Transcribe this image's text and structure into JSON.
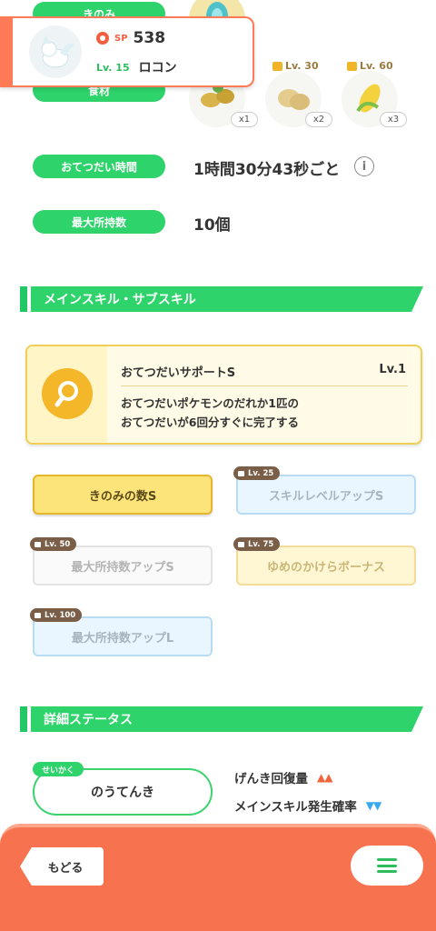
{
  "labels": {
    "berry": "きのみ",
    "ingredient": "食材",
    "help_time": "おてつだい時間",
    "max_carry": "最大所持数"
  },
  "values": {
    "help_time": "1時間30分43秒ごと",
    "max_carry": "10個"
  },
  "pokemon": {
    "sp_label": "SP",
    "sp_value": "538",
    "level": "Lv. 15",
    "name": "ロコン"
  },
  "ingredients": [
    {
      "level": "",
      "count": "x1"
    },
    {
      "level": "Lv. 30",
      "count": "x2"
    },
    {
      "level": "Lv. 60",
      "count": "x3"
    }
  ],
  "sections": {
    "skills": "メインスキル・サブスキル",
    "details": "詳細ステータス"
  },
  "main_skill": {
    "name": "おてつだいサポートS",
    "level": "Lv.1",
    "desc_line1": "おてつだいポケモンのだれか1匹の",
    "desc_line2": "おてつだいが6回分すぐに完了する"
  },
  "sub_skills": [
    {
      "label": "きのみの数S",
      "unlock": ""
    },
    {
      "label": "スキルレベルアップS",
      "unlock": "Lv. 25"
    },
    {
      "label": "最大所持数アップS",
      "unlock": "Lv. 50"
    },
    {
      "label": "ゆめのかけらボーナス",
      "unlock": "Lv. 75"
    },
    {
      "label": "最大所持数アップL",
      "unlock": "Lv. 100"
    }
  ],
  "nature": {
    "tag": "せいかく",
    "value": "のうてんき",
    "up_stat": "げんき回復量",
    "up_arrows": "▲▲",
    "down_stat": "メインスキル発生確率",
    "down_arrows": "▼▼"
  },
  "nav": {
    "back": "もどる"
  },
  "colors": {
    "accent_green": "#2ed36b",
    "bottom_bar": "#f7734f",
    "skill_gold": "#f5b72a"
  }
}
